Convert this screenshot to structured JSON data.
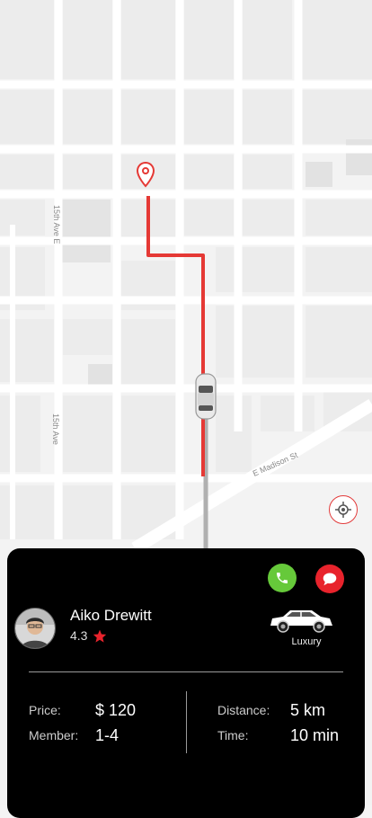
{
  "map": {
    "streets": [
      "15th Ave E",
      "15th Ave",
      "E Madison St"
    ],
    "route_color": "#e53935",
    "map_background": "#f4f4f4"
  },
  "icons": {
    "locate": "crosshair-icon",
    "pin": "map-pin-icon",
    "vehicle": "car-icon",
    "call": "phone-icon",
    "chat": "chat-bubble-icon",
    "rating": "star-icon"
  },
  "driver": {
    "name": "Aiko Drewitt",
    "rating": "4.3",
    "car_type": "Luxury"
  },
  "trip": {
    "price_label": "Price:",
    "price_value": "$ 120",
    "member_label": "Member:",
    "member_value": "1-4",
    "distance_label": "Distance:",
    "distance_value": "5 km",
    "time_label": "Time:",
    "time_value": "10 min"
  },
  "colors": {
    "call": "#66c93a",
    "chat": "#e8232c",
    "sheet": "#000000",
    "star": "#e8232c"
  }
}
